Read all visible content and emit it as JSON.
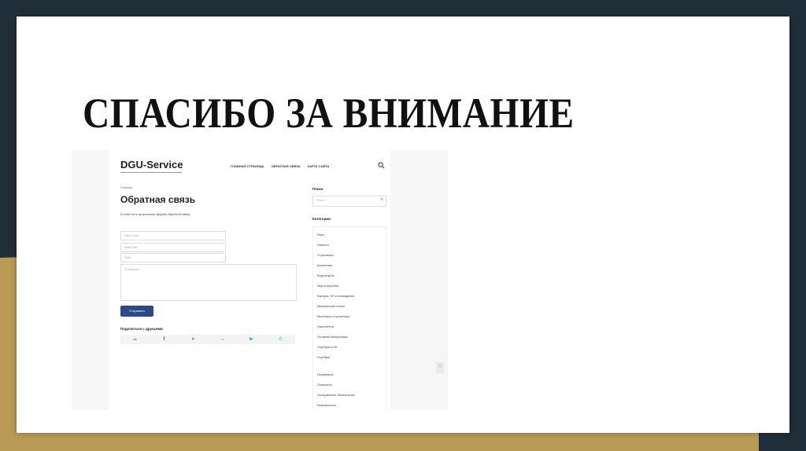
{
  "slide": {
    "title": "СПАСИБО ЗА ВНИМАНИЕ"
  },
  "site": {
    "logo": "DGU-Service",
    "nav": [
      "ГЛАВНАЯ СТРАНИЦА",
      "ОБРАТНАЯ СВЯЗЬ",
      "КАРТА САЙТА"
    ],
    "breadcrumb": "Главная",
    "page_title": "Обратная связь",
    "description": "В теме есть встроенная форма обратной связи",
    "form": {
      "name_placeholder": "Ваше имя",
      "email_placeholder": "Ваш e-mail",
      "subject_placeholder": "Тема",
      "message_placeholder": "Сообщение",
      "submit_label": "Отправить"
    },
    "share": {
      "label": "Поделиться с друзьями",
      "icons": [
        "vk-icon",
        "facebook-icon",
        "telegram-icon",
        "odnoklassniki-icon",
        "twitter-icon",
        "whatsapp-icon"
      ],
      "glyphs": [
        "vk",
        "f",
        "➤",
        "ок",
        "🐦",
        "✆"
      ],
      "colors": [
        "#4a76a8",
        "#3b5998",
        "#2ca5e0",
        "#ee8208",
        "#1da1f2",
        "#25d366"
      ]
    },
    "sidebar": {
      "search_title": "Поиск",
      "search_placeholder": "Поиск...",
      "categories_title": "Категории",
      "categories": [
        "Игры",
        "Новости",
        "IT-финансы",
        "Аналитика",
        "Видеокарты",
        "Звук и акустика",
        "Корпуса, БП и охлаждение",
        "Материнские платы",
        "Мониторы и проекторы",
        "Накопители",
        "Носимая электроника",
        "Ноутбуки и ПК",
        "Ноутбуки",
        "Периферия",
        "Планшеты",
        "Программное обеспечение",
        "Безопасность"
      ]
    },
    "colors": {
      "button": "#2a4a8a",
      "slide_dark": "#1f2e38",
      "slide_gold": "#b99a55"
    }
  }
}
